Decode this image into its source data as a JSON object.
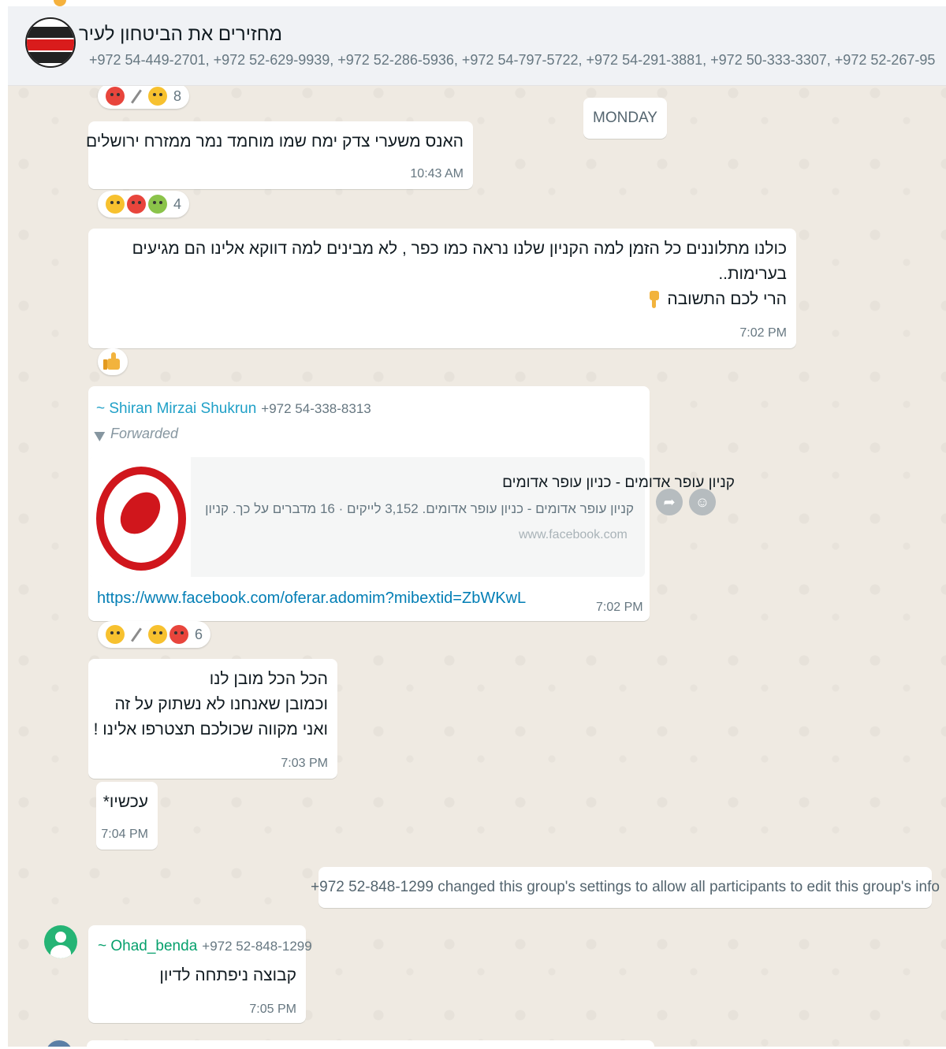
{
  "header": {
    "title": "מחזירים את הביטחון לעיר",
    "members": "+972 54-449-2701, +972 52-629-9939, +972 52-286-5936, +972 54-797-5722, +972 54-291-3881, +972 50-333-3307, +972 52-267-95",
    "avatar_icon": "group-logo-icon"
  },
  "day_separator": "MONDAY",
  "messages": [
    {
      "text": "האנס משערי צדק ימח שמו מוחמד נמר ממזרח ירושלים",
      "time": "10:43 AM",
      "reactions_count": "4"
    },
    {
      "lines": [
        "כולנו מתלוננים כל הזמן למה הקניון שלנו נראה כמו כפר , לא מבינים למה דווקא אלינו הם מגיעים",
        "בערימות..",
        "הרי לכם התשובה"
      ],
      "time": "7:02 PM",
      "pointing_icon": "pointing-down-icon"
    },
    {
      "sender": "~ Shiran Mirzai Shukrun",
      "sender_phone": "+972 54-338-8313",
      "forwarded_label": "Forwarded",
      "preview": {
        "title": "קניון עופר אדומים - כניון עופר אדומים",
        "description": "קניון עופר אדומים - כניון עופר אדומים. 3,152 לייקים · 16 מדברים על כך. קניון",
        "domain": "www.facebook.com"
      },
      "url": "https://www.facebook.com/oferar.adomim?mibextid=ZbWKwL",
      "time": "7:02 PM",
      "reactions_count": "6"
    },
    {
      "lines": [
        "הכל הכל מובן לנו",
        "וכמובן שאנחנו לא נשתוק על זה",
        "ואני מקווה שכולכם תצטרפו אלינו !"
      ],
      "time": "7:03 PM"
    },
    {
      "text": "עכשיו*",
      "time": "7:04 PM"
    },
    {
      "sender": "~ Ohad_benda",
      "sender_phone": "+972 52-848-1299",
      "text": "קבוצה ניפתחה לדיון",
      "time": "7:05 PM"
    }
  ],
  "top_reactions_count": "8",
  "system_message": "+972 52-848-1299 changed this group's settings to allow all participants to edit this group's info",
  "colors": {
    "chat_bg": "#efeae2",
    "header_bg": "#f0f2f5",
    "link": "#027eb5",
    "sender_blue": "#1fa0c7",
    "sender_green": "#06a06c"
  }
}
